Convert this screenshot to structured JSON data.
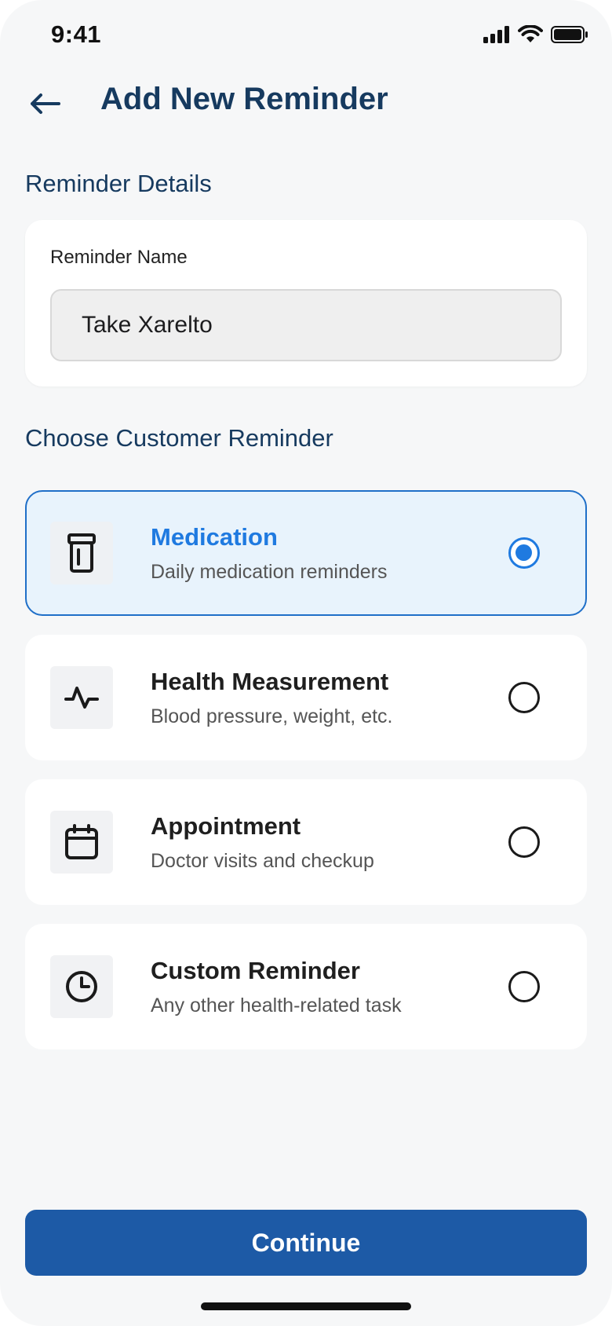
{
  "status_bar": {
    "time": "9:41",
    "icons": [
      "signal-icon",
      "wifi-icon",
      "battery-icon"
    ]
  },
  "header": {
    "back_icon": "arrow-left-icon",
    "title": "Add New Reminder"
  },
  "details_section": {
    "title": "Reminder Details",
    "field_label": "Reminder Name",
    "field_value": "Take Xarelto"
  },
  "type_section": {
    "title": "Choose Customer Reminder",
    "options": [
      {
        "title": "Medication",
        "subtitle": "Daily medication reminders",
        "icon": "pill-bottle-icon",
        "selected": true
      },
      {
        "title": "Health Measurement",
        "subtitle": "Blood pressure, weight, etc.",
        "icon": "pulse-icon",
        "selected": false
      },
      {
        "title": "Appointment",
        "subtitle": "Doctor visits and checkup",
        "icon": "calendar-icon",
        "selected": false
      },
      {
        "title": "Custom Reminder",
        "subtitle": "Any other health-related task",
        "icon": "clock-icon",
        "selected": false
      }
    ]
  },
  "footer": {
    "continue_label": "Continue"
  },
  "colors": {
    "accent": "#1f7ae0",
    "primary_button": "#1d5aa6",
    "heading": "#163a5f",
    "selected_bg": "#e8f3fc"
  }
}
